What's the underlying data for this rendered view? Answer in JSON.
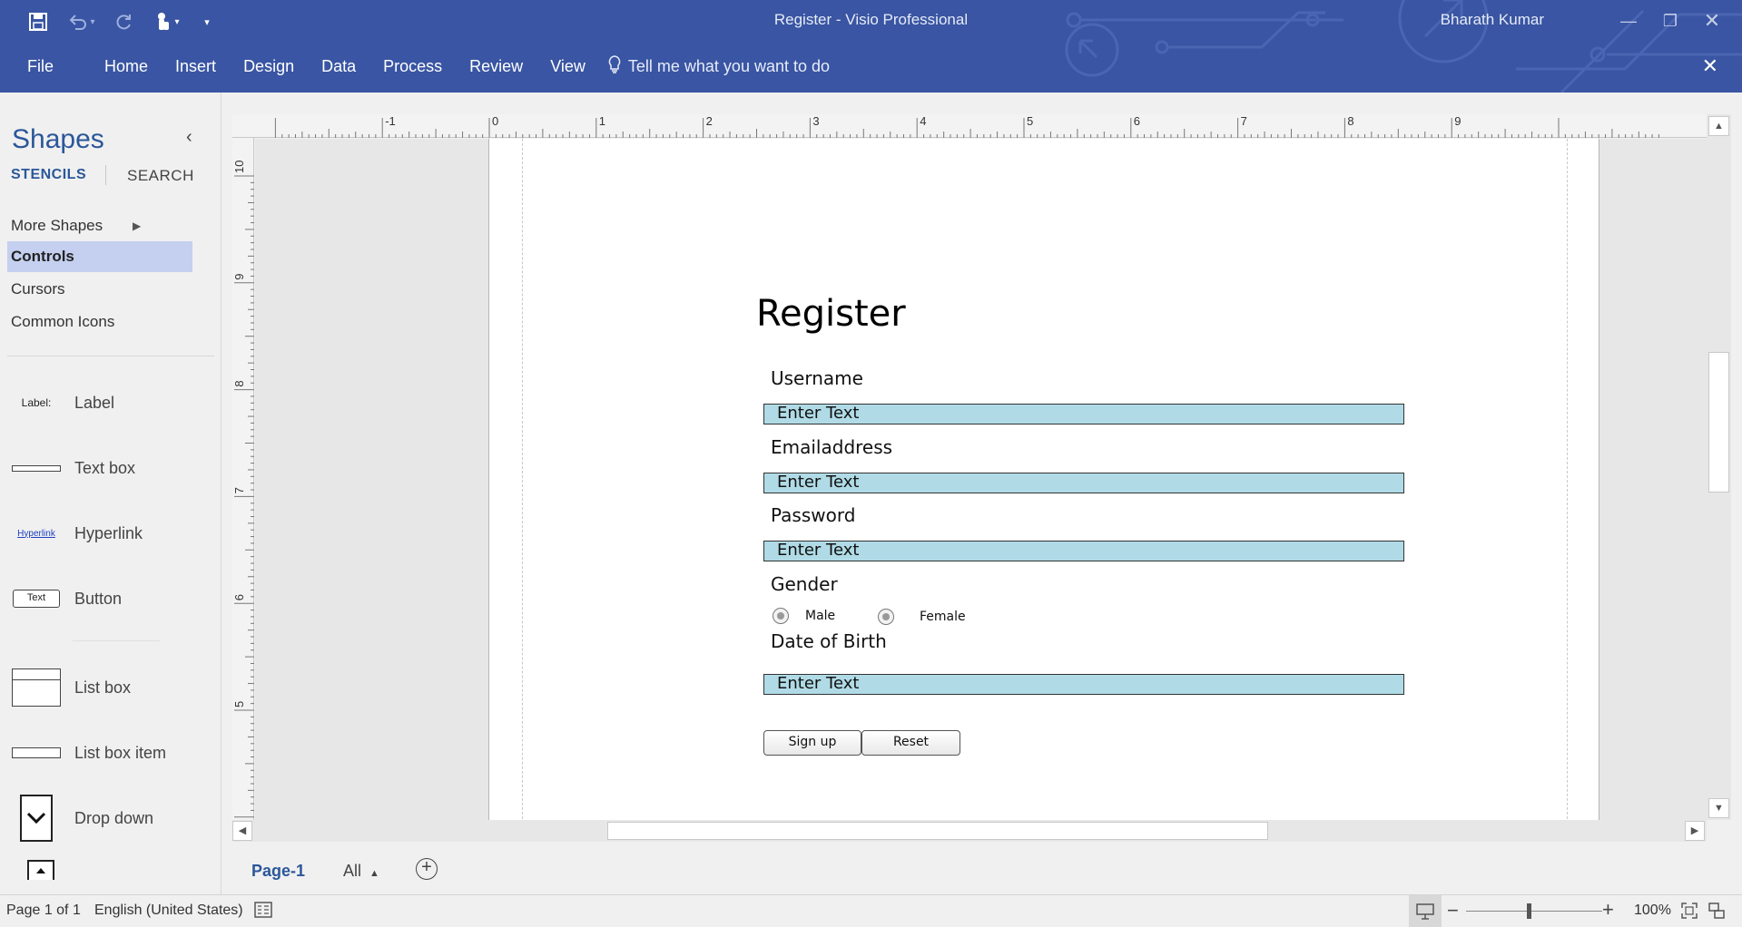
{
  "window": {
    "title": "Register - Visio Professional",
    "user": "Bharath Kumar",
    "accent_color": "#3955a3"
  },
  "quick_access": [
    "save-icon",
    "undo-icon",
    "redo-icon",
    "touch-mode-icon",
    "customize-qat-icon"
  ],
  "ribbon": {
    "tabs": [
      "File",
      "Home",
      "Insert",
      "Design",
      "Data",
      "Process",
      "Review",
      "View"
    ],
    "tell_me": "Tell me what you want to do"
  },
  "shapes_pane": {
    "title": "Shapes",
    "stencils_tab": "STENCILS",
    "search_tab": "SEARCH",
    "stencils": [
      {
        "label": "More Shapes",
        "selected": false
      },
      {
        "label": "Controls",
        "selected": true
      },
      {
        "label": "Cursors",
        "selected": false
      },
      {
        "label": "Common Icons",
        "selected": false
      }
    ],
    "shapes": [
      {
        "label": "Label",
        "icon_text": "Label:"
      },
      {
        "label": "Text box",
        "icon_text": ""
      },
      {
        "label": "Hyperlink",
        "icon_text": "Hyperlink"
      },
      {
        "label": "Button",
        "icon_text": "Text"
      },
      {
        "label": "List box",
        "icon_text": ""
      },
      {
        "label": "List box item",
        "icon_text": ""
      },
      {
        "label": "Drop down",
        "icon_text": ""
      }
    ]
  },
  "rulers": {
    "horizontal": [
      "-1",
      "0",
      "1",
      "2",
      "3",
      "4",
      "5",
      "6",
      "7",
      "8",
      "9"
    ],
    "vertical": [
      "10",
      "9",
      "8",
      "7",
      "6",
      "5"
    ]
  },
  "form": {
    "title": "Register",
    "fields": [
      {
        "label": "Username",
        "value": "Enter Text"
      },
      {
        "label": "Emailaddress",
        "value": "Enter Text"
      },
      {
        "label": "Password",
        "value": "Enter Text"
      }
    ],
    "gender": {
      "label": "Gender",
      "options": [
        "Male",
        "Female"
      ]
    },
    "dob": {
      "label": "Date of Birth",
      "value": "Enter Text"
    },
    "buttons": {
      "submit": "Sign up",
      "reset": "Reset"
    }
  },
  "page_tabs": {
    "active": "Page-1",
    "all": "All"
  },
  "status": {
    "page": "Page 1 of 1",
    "language": "English (United States)",
    "zoom": "100%",
    "zoom_fraction": 0.46
  }
}
